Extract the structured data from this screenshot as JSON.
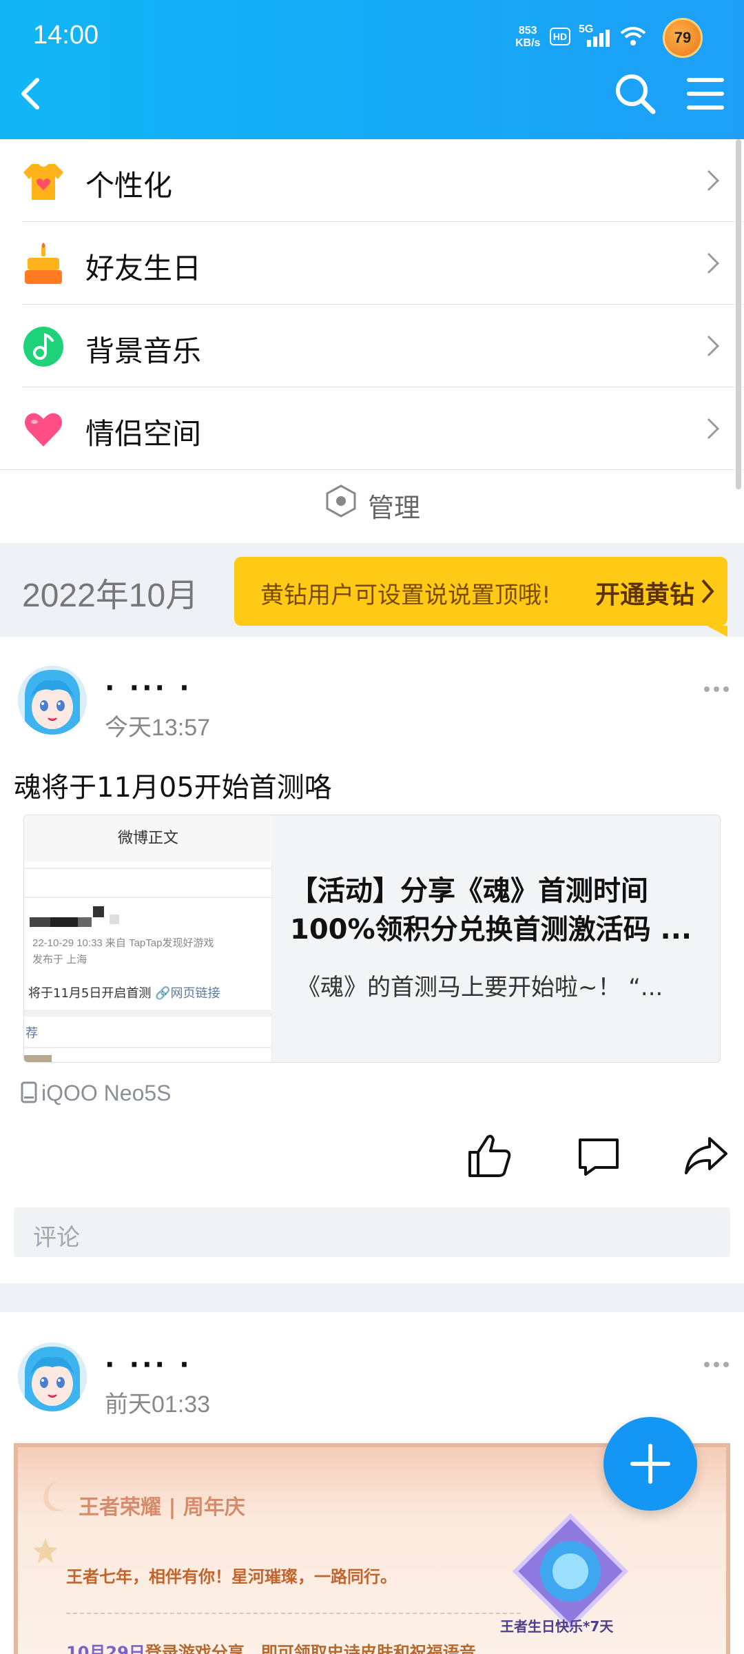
{
  "status_bar": {
    "time": "14:00",
    "speed_value": "853",
    "speed_unit": "KB/s",
    "hd": "HD",
    "network": "5G",
    "battery": "79"
  },
  "menu": {
    "items": [
      {
        "label": "个性化",
        "icon": "tshirt-heart-icon"
      },
      {
        "label": "好友生日",
        "icon": "birthday-cake-icon"
      },
      {
        "label": "背景音乐",
        "icon": "music-note-icon"
      },
      {
        "label": "情侣空间",
        "icon": "heart-icon"
      }
    ],
    "manage_label": "管理"
  },
  "month_bar": {
    "month": "2022年10月",
    "promo_text": "黄钻用户可设置说说置顶哦!",
    "promo_cta": "开通黄钻"
  },
  "posts": [
    {
      "name": "· ··· ·",
      "time": "今天13:57",
      "text": "魂将于11月05开始首测咯",
      "share": {
        "thumb_title": "微博正文",
        "thumb_meta1": "22-10-29 10:33  来自 TapTap发现好游戏",
        "thumb_meta2": "发布于 上海",
        "thumb_body": "将于11月5日开启首测",
        "thumb_link": "网页链接",
        "thumb_rec": "荐",
        "title_line1": "【活动】分享《魂》首测时间",
        "title_line2": "100%领积分兑换首测激活码 ...",
        "desc": "《魂》的首测马上要开始啦~！  “..."
      },
      "device": "iQOO Neo5S",
      "comment_placeholder": "评论"
    },
    {
      "name": "· ··· ·",
      "time": "前天01:33",
      "banner": {
        "logo": "王者荣耀 | 周年庆",
        "line1": "王者七年，相伴有你！星河璀璨，一路同行。",
        "date": "10月29日",
        "line2_rest": "登录游戏分享，即可领取史诗皮肤和祝福语音。",
        "gem_label": "王者生日快乐*7天"
      }
    }
  ],
  "colors": {
    "header": "#16a8f6",
    "promo": "#ffca16",
    "fab": "#1496f5"
  }
}
